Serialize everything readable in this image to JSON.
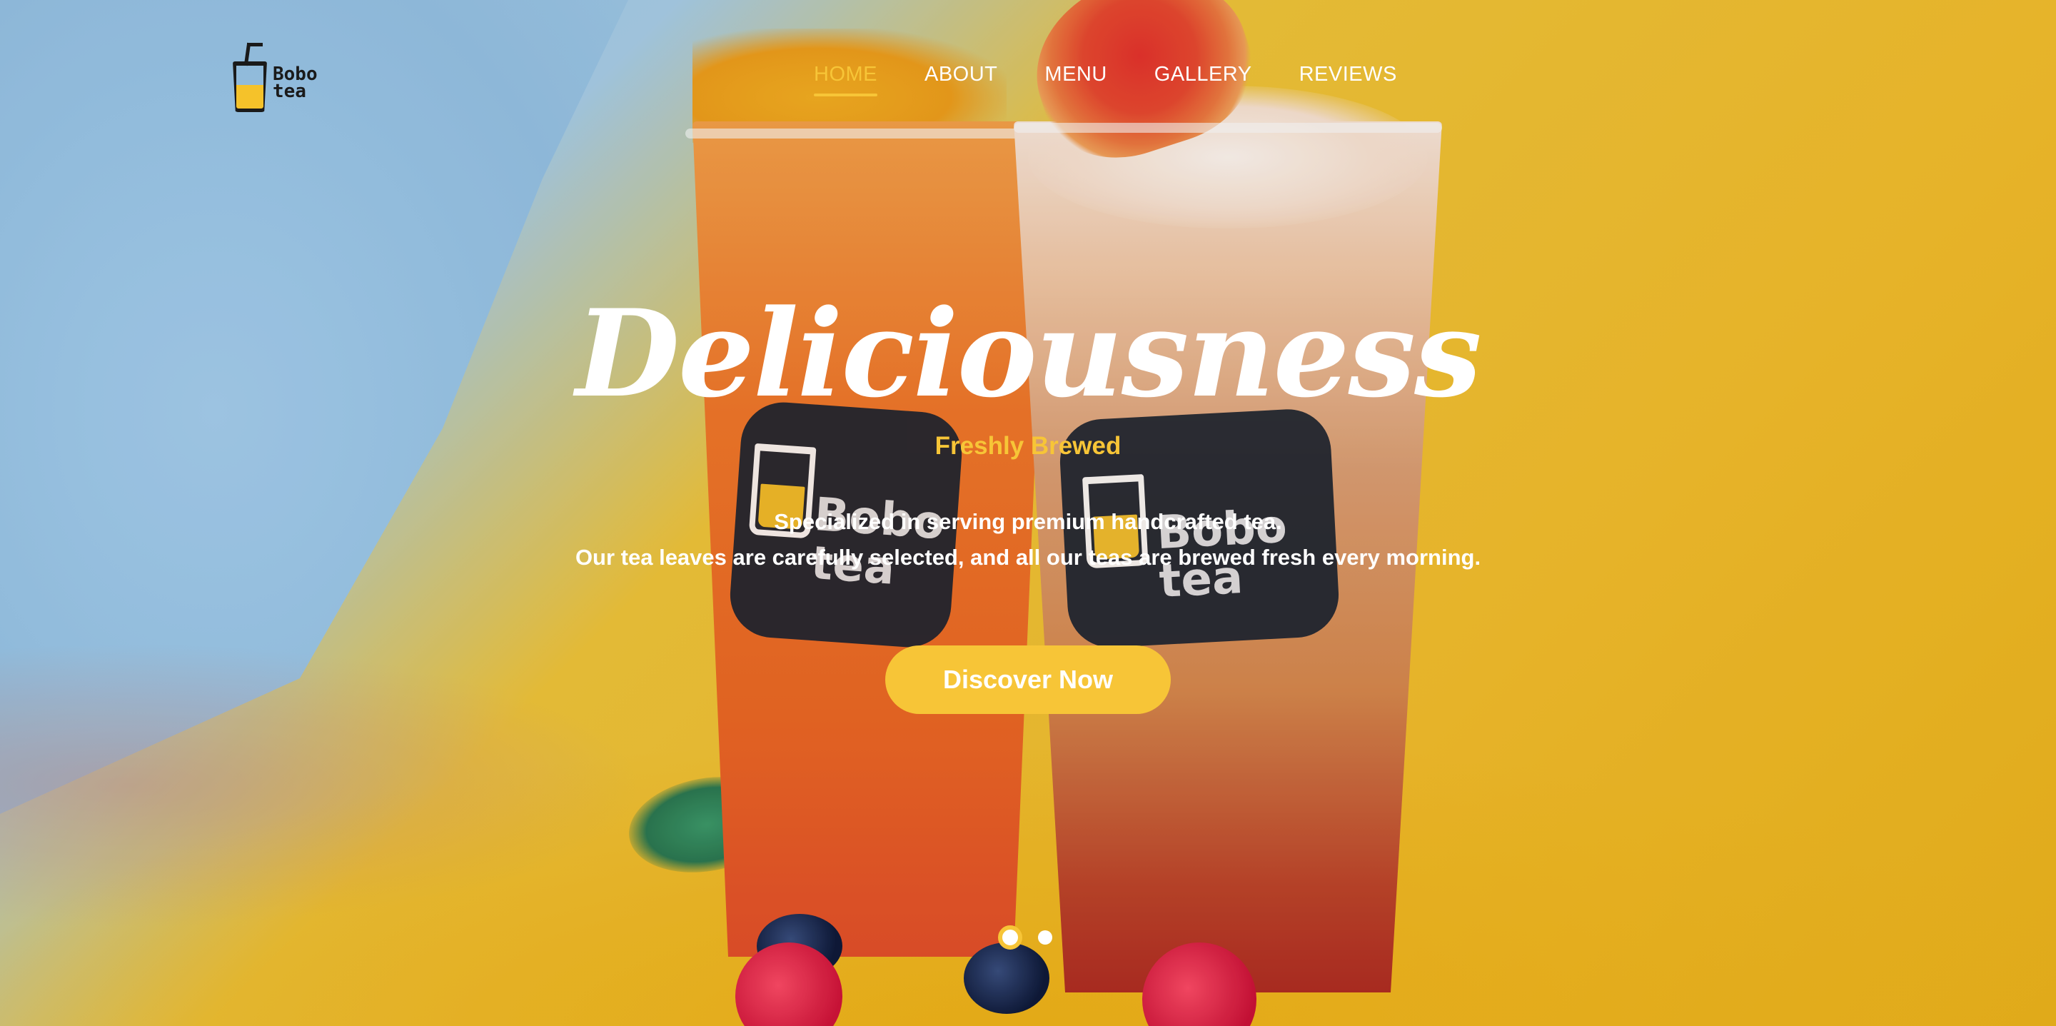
{
  "brand": {
    "logo_line1": "Bobo",
    "logo_line2": "tea",
    "accent_color": "#f7c537"
  },
  "nav": {
    "items": [
      {
        "label": "HOME",
        "active": true
      },
      {
        "label": "ABOUT",
        "active": false
      },
      {
        "label": "MENU",
        "active": false
      },
      {
        "label": "GALLERY",
        "active": false
      },
      {
        "label": "REVIEWS",
        "active": false
      }
    ]
  },
  "hero": {
    "headline": "Deliciousness",
    "tagline": "Freshly Brewed",
    "description_line1": "Specialized in serving premium handcrafted tea.",
    "description_line2": "Our tea leaves are carefully selected, and all our teas are brewed fresh every morning.",
    "cta_label": "Discover Now",
    "cup_label_line1": "Bobo",
    "cup_label_line2": "tea"
  },
  "carousel": {
    "slide_count": 2,
    "active_index": 0
  }
}
